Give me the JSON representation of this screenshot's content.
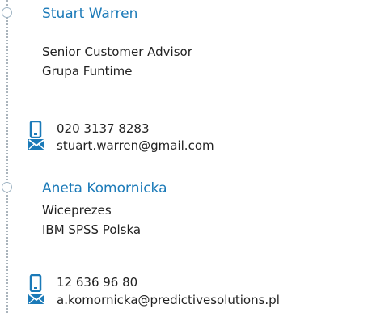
{
  "contacts": [
    {
      "name": "Stuart Warren",
      "title": "Senior Customer Advisor",
      "company": "Grupa Funtime",
      "phone": "020 3137 8283",
      "email": "stuart.warren@gmail.com"
    },
    {
      "name": "Aneta Komornicka",
      "title": "Wiceprezes",
      "company": "IBM SPSS Polska",
      "phone": "12 636 96 80",
      "email": "a.komornicka@predictivesolutions.pl"
    }
  ],
  "icons": {
    "phone": "phone-icon",
    "email": "email-icon"
  },
  "colors": {
    "accent": "#1b7ab8",
    "text": "#222222",
    "timeline": "#a9b3bb"
  }
}
